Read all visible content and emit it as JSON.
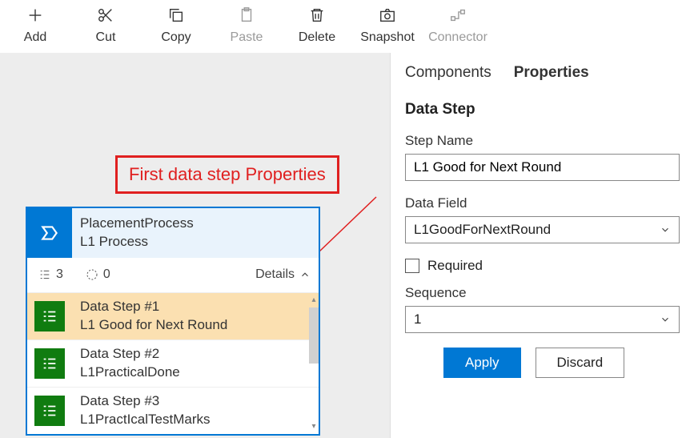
{
  "toolbar": [
    {
      "id": "add",
      "label": "Add",
      "disabled": false
    },
    {
      "id": "cut",
      "label": "Cut",
      "disabled": false
    },
    {
      "id": "copy",
      "label": "Copy",
      "disabled": false
    },
    {
      "id": "paste",
      "label": "Paste",
      "disabled": true
    },
    {
      "id": "delete",
      "label": "Delete",
      "disabled": false
    },
    {
      "id": "snapshot",
      "label": "Snapshot",
      "disabled": false
    },
    {
      "id": "connector",
      "label": "Connector",
      "disabled": true
    }
  ],
  "annotation": "First data step Properties",
  "process": {
    "title": "PlacementProcess",
    "subtitle": "L1 Process",
    "count1": "3",
    "count2": "0",
    "details_label": "Details"
  },
  "steps": [
    {
      "title": "Data Step #1",
      "sub": "L1 Good for Next Round",
      "selected": true
    },
    {
      "title": "Data Step #2",
      "sub": "L1PracticalDone",
      "selected": false
    },
    {
      "title": "Data Step #3",
      "sub": "L1PractIcalTestMarks",
      "selected": false
    }
  ],
  "tabs": {
    "components": "Components",
    "properties": "Properties",
    "active": "properties"
  },
  "panel": {
    "section_title": "Data Step",
    "step_name_label": "Step Name",
    "step_name_value": "L1 Good for Next Round",
    "data_field_label": "Data Field",
    "data_field_value": "L1GoodForNextRound",
    "required_label": "Required",
    "required_checked": false,
    "sequence_label": "Sequence",
    "sequence_value": "1",
    "apply_label": "Apply",
    "discard_label": "Discard"
  }
}
